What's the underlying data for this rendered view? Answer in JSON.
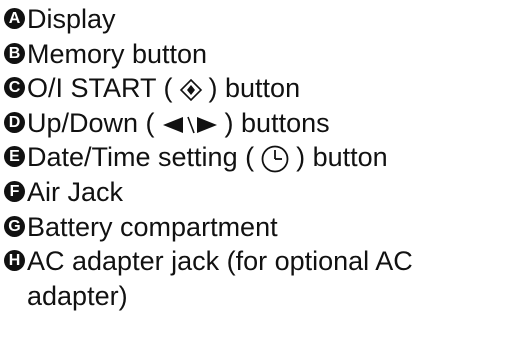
{
  "legend": {
    "items": [
      {
        "letter": "A",
        "parts": [
          "Display"
        ]
      },
      {
        "letter": "B",
        "parts": [
          "Memory button"
        ]
      },
      {
        "letter": "C",
        "parts": [
          "O/I START (",
          ") button"
        ],
        "icon": "start-diamond-icon"
      },
      {
        "letter": "D",
        "parts": [
          "Up/Down (",
          ") buttons"
        ],
        "icon": "left-right-arrows-icon"
      },
      {
        "letter": "E",
        "parts": [
          "Date/Time setting (",
          ") button"
        ],
        "icon": "clock-icon"
      },
      {
        "letter": "F",
        "parts": [
          "Air Jack"
        ]
      },
      {
        "letter": "G",
        "parts": [
          "Battery compartment"
        ]
      },
      {
        "letter": "H",
        "parts": [
          "AC adapter jack (for optional AC",
          "adapter)"
        ]
      }
    ]
  }
}
